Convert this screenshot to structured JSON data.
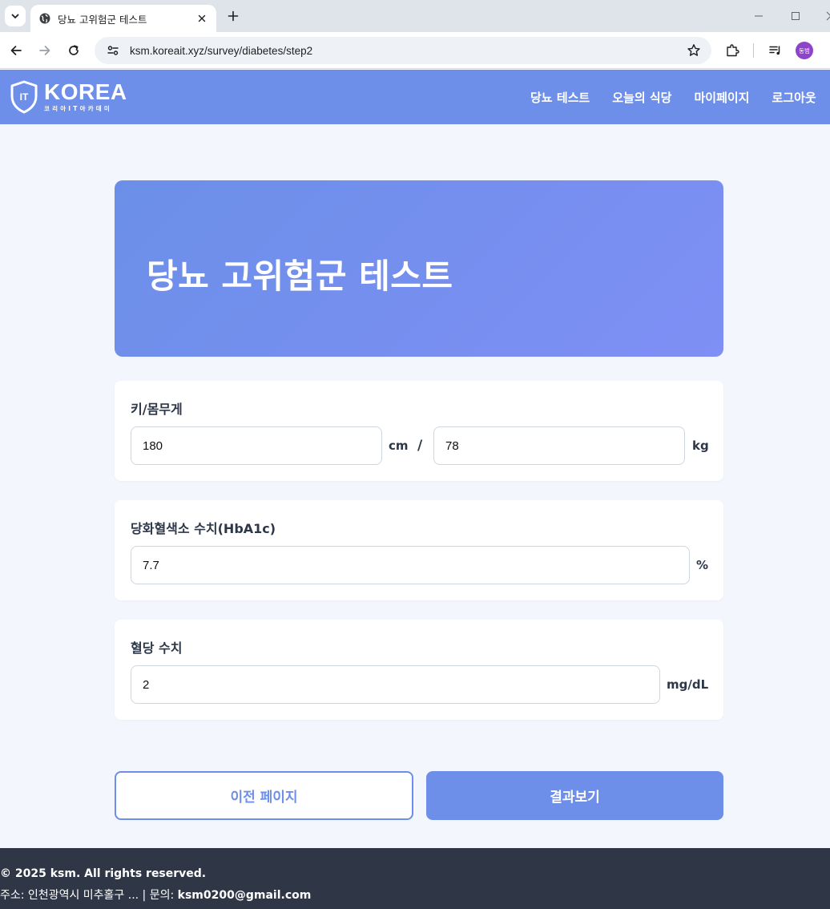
{
  "browser": {
    "tab_title": "당뇨 고위험군 테스트",
    "url": "ksm.koreait.xyz/survey/diabetes/step2",
    "profile_initials": "동범"
  },
  "header": {
    "logo_mark": "IT",
    "logo_main": "KOREA",
    "logo_sub": "코리아IT아카데미",
    "nav": [
      "당뇨 테스트",
      "오늘의 식당",
      "마이페이지",
      "로그아웃"
    ],
    "color": "#6d8fea"
  },
  "hero": {
    "title": "당뇨 고위험군 테스트"
  },
  "form": {
    "height_weight": {
      "label": "키/몸무게",
      "height_value": "180",
      "height_unit": "cm",
      "separator": "/",
      "weight_value": "78",
      "weight_unit": "kg"
    },
    "hba1c": {
      "label": "당화혈색소 수치(HbA1c)",
      "value": "7.7",
      "unit": "%"
    },
    "glucose": {
      "label": "혈당 수치",
      "value": "2",
      "unit": "mg/dL"
    }
  },
  "buttons": {
    "prev": "이전 페이지",
    "result": "결과보기"
  },
  "footer": {
    "copyright": "© 2025 ksm. All rights reserved.",
    "address": "주소: 인천광역시 미추홀구 ... | 문의: ",
    "email": "ksm0200@gmail.com"
  }
}
